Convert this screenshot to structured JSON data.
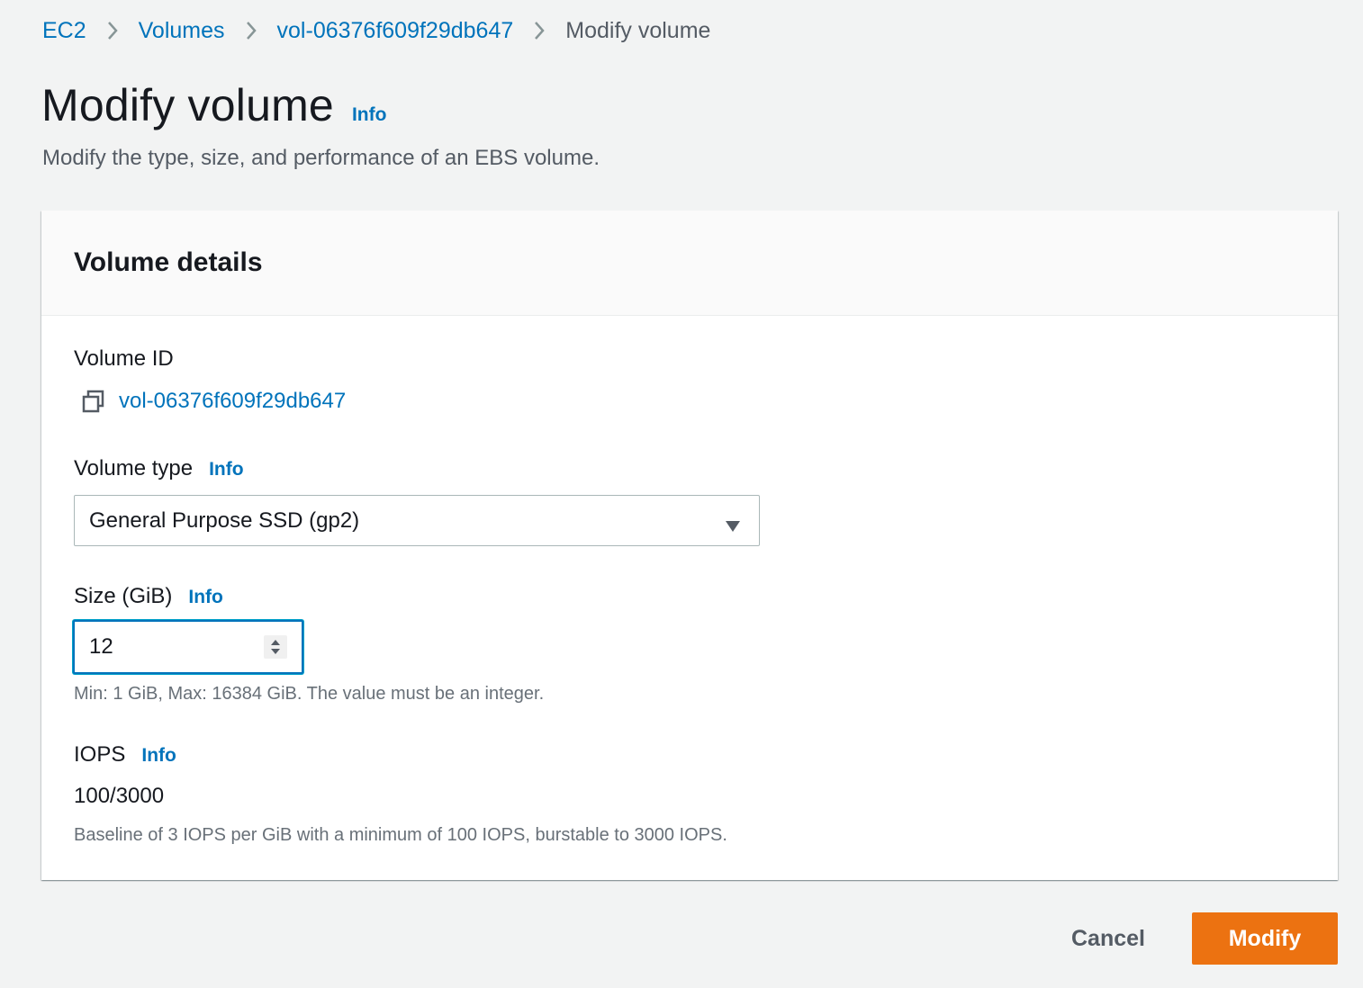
{
  "breadcrumb": {
    "items": [
      "EC2",
      "Volumes",
      "vol-06376f609f29db647"
    ],
    "current": "Modify volume"
  },
  "header": {
    "title": "Modify volume",
    "info": "Info",
    "description": "Modify the type, size, and performance of an EBS volume."
  },
  "panel": {
    "title": "Volume details",
    "volume_id": {
      "label": "Volume ID",
      "value": "vol-06376f609f29db647",
      "icon": "copy-icon"
    },
    "volume_type": {
      "label": "Volume type",
      "info": "Info",
      "selected": "General Purpose SSD (gp2)",
      "icon": "caret-down-icon"
    },
    "size": {
      "label": "Size (GiB)",
      "info": "Info",
      "value": "12",
      "help": "Min: 1 GiB, Max: 16384 GiB. The value must be an integer."
    },
    "iops": {
      "label": "IOPS",
      "info": "Info",
      "value": "100/3000",
      "help": "Baseline of 3 IOPS per GiB with a minimum of 100 IOPS, burstable to 3000 IOPS."
    }
  },
  "actions": {
    "cancel": "Cancel",
    "modify": "Modify"
  },
  "colors": {
    "link": "#0073bb",
    "primary_button": "#ec7211",
    "focus_border": "#0073bb",
    "background": "#f2f3f3"
  }
}
